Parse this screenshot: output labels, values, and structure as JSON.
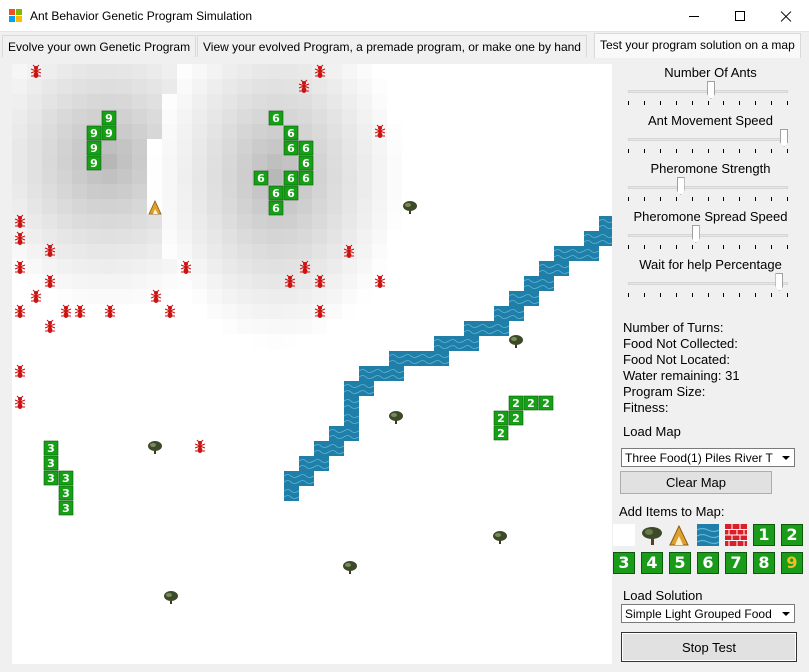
{
  "window": {
    "title": "Ant Behavior Genetic Program Simulation",
    "app_icon": "windows-form-icon",
    "controls": [
      "minimize-icon",
      "maximize-icon",
      "close-icon"
    ]
  },
  "tabs": [
    {
      "label": "Evolve your own Genetic Program",
      "active": false
    },
    {
      "label": "View your evolved Program, a premade program, or make one by hand",
      "active": false
    },
    {
      "label": "Test your program solution on a map",
      "active": true
    }
  ],
  "sliders": [
    {
      "label": "Number Of Ants",
      "value_fraction": 0.52
    },
    {
      "label": "Ant Movement Speed",
      "value_fraction": 1.0
    },
    {
      "label": "Pheromone Strength",
      "value_fraction": 0.32
    },
    {
      "label": "Pheromone Spread Speed",
      "value_fraction": 0.42
    },
    {
      "label": "Wait for help Percentage",
      "value_fraction": 0.97
    }
  ],
  "stats": {
    "turns": "Number of Turns:",
    "food_not_collected": "Food Not Collected:",
    "food_not_located": "Food Not Located:",
    "water_remaining": "Water remaining: 31",
    "program_size": "Program Size:",
    "fitness": "Fitness:"
  },
  "load_map": {
    "label": "Load Map",
    "selected": "Three Food(1) Piles River T",
    "clear_button": "Clear Map"
  },
  "add_items": {
    "label": "Add Items to Map:",
    "row1": [
      {
        "name": "empty-tile",
        "text": ""
      },
      {
        "name": "tree-icon",
        "text": ""
      },
      {
        "name": "nest-icon",
        "text": ""
      },
      {
        "name": "water-tile",
        "text": ""
      },
      {
        "name": "brick-wall-icon",
        "text": ""
      },
      {
        "name": "food-1",
        "text": "1"
      },
      {
        "name": "food-2",
        "text": "2"
      }
    ],
    "row2": [
      {
        "name": "food-3",
        "text": "3"
      },
      {
        "name": "food-4",
        "text": "4"
      },
      {
        "name": "food-5",
        "text": "5"
      },
      {
        "name": "food-6",
        "text": "6"
      },
      {
        "name": "food-7",
        "text": "7"
      },
      {
        "name": "food-8",
        "text": "8"
      },
      {
        "name": "food-9",
        "text": "9"
      }
    ]
  },
  "load_solution": {
    "label": "Load Solution",
    "selected": "Simple Light Grouped Food",
    "stop_button": "Stop Test"
  },
  "map": {
    "food_piles": [
      {
        "label": "3",
        "cells": [
          [
            2,
            26
          ],
          [
            2,
            27
          ],
          [
            2,
            28
          ],
          [
            3,
            28
          ],
          [
            3,
            29
          ],
          [
            3,
            30
          ]
        ]
      },
      {
        "label": "2",
        "cells": [
          [
            33,
            23
          ],
          [
            34,
            23
          ],
          [
            35,
            23
          ],
          [
            32,
            24
          ],
          [
            33,
            24
          ],
          [
            32,
            25
          ]
        ]
      },
      {
        "label": "6",
        "cells": [
          [
            17,
            4
          ],
          [
            18,
            5
          ],
          [
            18,
            6
          ],
          [
            19,
            6
          ],
          [
            19,
            7
          ],
          [
            18,
            8
          ],
          [
            19,
            8
          ],
          [
            18,
            9
          ],
          [
            17,
            9
          ],
          [
            17,
            10
          ],
          [
            16,
            8
          ]
        ]
      },
      {
        "label": "9",
        "cells": [
          [
            6,
            4
          ],
          [
            5,
            5
          ],
          [
            6,
            5
          ],
          [
            5,
            6
          ],
          [
            5,
            7
          ]
        ]
      }
    ],
    "colors": {
      "food": "#16a016",
      "water": "#1f7fa8",
      "ant": "#cc1111",
      "nest": "#e0a030",
      "tree": "#3d4a2a"
    }
  }
}
